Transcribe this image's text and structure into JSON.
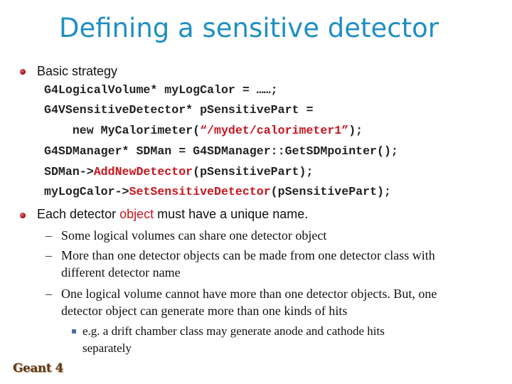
{
  "slide": {
    "title": "Defining a sensitive detector",
    "bullets": [
      {
        "text": "Basic strategy",
        "code_lines": [
          [
            {
              "t": "G4LogicalVolume* myLogCalor = ……;",
              "red": false
            }
          ],
          [
            {
              "t": "G4VSensitiveDetector* pSensitivePart =",
              "red": false
            }
          ],
          [
            {
              "t": "    new MyCalorimeter(",
              "red": false
            },
            {
              "t": "“/mydet/calorimeter1”",
              "red": true
            },
            {
              "t": ");",
              "red": false
            }
          ],
          [
            {
              "t": "G4SDManager* SDMan = G4SDManager::GetSDMpointer();",
              "red": false
            }
          ],
          [
            {
              "t": "SDMan->",
              "red": false
            },
            {
              "t": "AddNewDetector",
              "red": true
            },
            {
              "t": "(pSensitivePart);",
              "red": false
            }
          ],
          [
            {
              "t": "myLogCalor->",
              "red": false
            },
            {
              "t": "SetSensitiveDetector",
              "red": true
            },
            {
              "t": "(pSensitivePart);",
              "red": false
            }
          ]
        ]
      },
      {
        "text_before": "Each detector ",
        "text_highlight": "object",
        "text_after": " must have a unique name.",
        "sub_items": [
          {
            "lines": [
              "Some logical volumes can share one detector object"
            ]
          },
          {
            "lines": [
              "More than one detector objects can be made from one detector class with",
              "different detector name"
            ]
          },
          {
            "lines": [
              "One logical volume cannot have more than one detector objects. But, one",
              "detector object can generate more than one kinds of hits"
            ],
            "sub_items": [
              {
                "lines": [
                  "e.g. a drift chamber class may generate anode and cathode hits",
                  "separately"
                ]
              }
            ]
          }
        ]
      }
    ],
    "dash_glyph": "–",
    "footer_logo": "Geant 4"
  },
  "colors": {
    "title": "#1f8fc4",
    "highlight_red": "#c8161d",
    "bullet_dot": "#b0161c",
    "sub_bullet_square": "#4a6fa5",
    "logo": "#5a3a1e"
  },
  "icons": {
    "level1_bullet": "red-sphere-bullet-icon",
    "level3_bullet": "blue-square-bullet-icon"
  }
}
